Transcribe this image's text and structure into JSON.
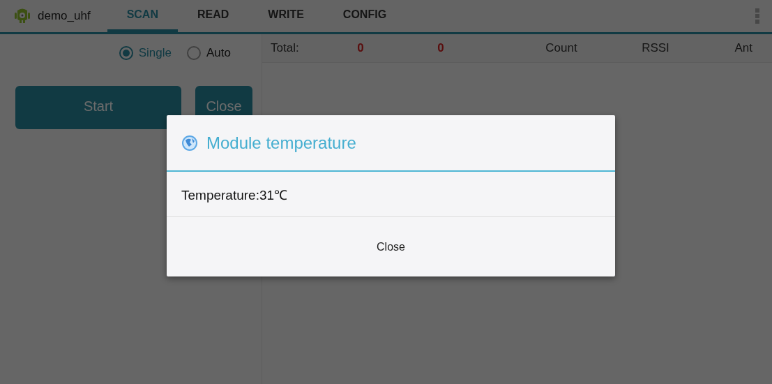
{
  "app": {
    "title": "demo_uhf"
  },
  "tabs": [
    {
      "label": "SCAN",
      "selected": true
    },
    {
      "label": "READ",
      "selected": false
    },
    {
      "label": "WRITE",
      "selected": false
    },
    {
      "label": "CONFIG",
      "selected": false
    }
  ],
  "mode_options": [
    {
      "label": "Single",
      "selected": true
    },
    {
      "label": "Auto",
      "selected": false
    }
  ],
  "buttons": [
    "Start",
    "Close"
  ],
  "table": {
    "total_label": "Total:",
    "total_values": [
      "0",
      "0"
    ],
    "columns": [
      "Count",
      "RSSI",
      "Ant"
    ]
  },
  "dialog": {
    "title": "Module temperature",
    "message": "Temperature:31℃",
    "button": "Close"
  }
}
